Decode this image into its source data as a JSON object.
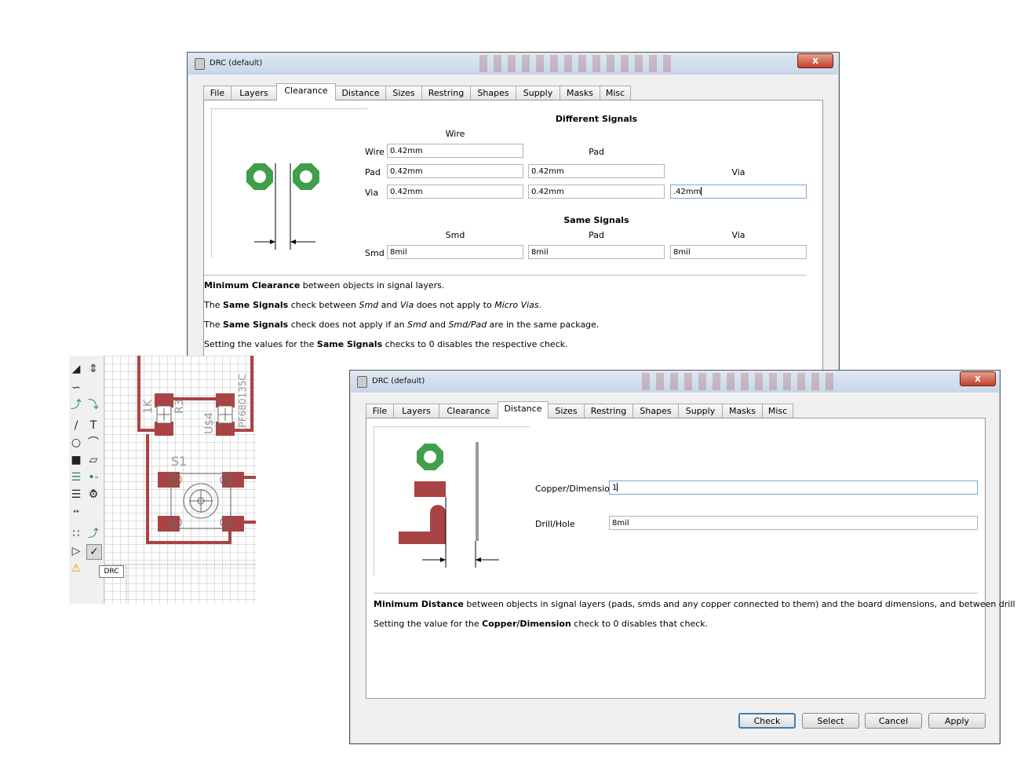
{
  "win1": {
    "title": "DRC (default)",
    "close": "x",
    "tabs": [
      "File",
      "Layers",
      "Clearance",
      "Distance",
      "Sizes",
      "Restring",
      "Shapes",
      "Supply",
      "Masks",
      "Misc"
    ],
    "active_tab": "Clearance",
    "different_signals": {
      "heading": "Different Signals",
      "col_wire": "Wire",
      "col_pad": "Pad",
      "col_via": "Via",
      "row_wire": "Wire",
      "row_pad": "Pad",
      "row_via": "Via",
      "wire_wire": "0.42mm",
      "pad_wire": "0.42mm",
      "pad_pad": "0.42mm",
      "via_wire": "0.42mm",
      "via_pad": "0.42mm",
      "via_via": ".42mm"
    },
    "same_signals": {
      "heading": "Same Signals",
      "col_smd": "Smd",
      "col_pad": "Pad",
      "col_via": "Via",
      "row_smd": "Smd",
      "smd_smd": "8mil",
      "smd_pad": "8mil",
      "smd_via": "8mil"
    },
    "desc": {
      "l1_b": "Minimum Clearance",
      "l1_r": " between objects in signal layers.",
      "l2_a": "The ",
      "l2_b": "Same Signals",
      "l2_c": " check between ",
      "l2_i1": "Smd",
      "l2_d": " and ",
      "l2_i2": "Via",
      "l2_e": " does not apply to ",
      "l2_i3": "Micro Vias",
      "l2_f": ".",
      "l3_a": "The ",
      "l3_b": "Same Signals",
      "l3_c": " check does not apply if an ",
      "l3_i1": "Smd",
      "l3_d": " and ",
      "l3_i2": "Smd/Pad",
      "l3_e": " are in the same package.",
      "l4_a": "Setting the values for the ",
      "l4_b": "Same Signals",
      "l4_c": " checks to 0 disables the respective check."
    }
  },
  "win2": {
    "title": "DRC (default)",
    "close": "x",
    "tabs": [
      "File",
      "Layers",
      "Clearance",
      "Distance",
      "Sizes",
      "Restring",
      "Shapes",
      "Supply",
      "Masks",
      "Misc"
    ],
    "active_tab": "Distance",
    "copper_label": "Copper/Dimension",
    "copper_value": "1",
    "drill_label": "Drill/Hole",
    "drill_value": "8mil",
    "desc": {
      "l1_b": "Minimum Distance",
      "l1_r": " between objects in signal layers (pads, smds and any copper connected to them) and the board dimensions, and between drill holes.",
      "l2_a": "Setting the value for the ",
      "l2_b": "Copper/Dimension",
      "l2_c": " check to 0 disables that check."
    },
    "buttons": {
      "check": "Check",
      "select": "Select",
      "cancel": "Cancel",
      "apply": "Apply"
    }
  },
  "board": {
    "labels": {
      "r_value": "1K",
      "r_name": "R3",
      "u_name": "U$4",
      "u_value": "IPF680135C",
      "switch": "S1"
    },
    "tooltip": "DRC"
  },
  "colors": {
    "copper": "#a94444",
    "pad_green": "#3f9f4a",
    "focus_border": "#7aa7d6",
    "default_button": "#3c7fb1"
  }
}
